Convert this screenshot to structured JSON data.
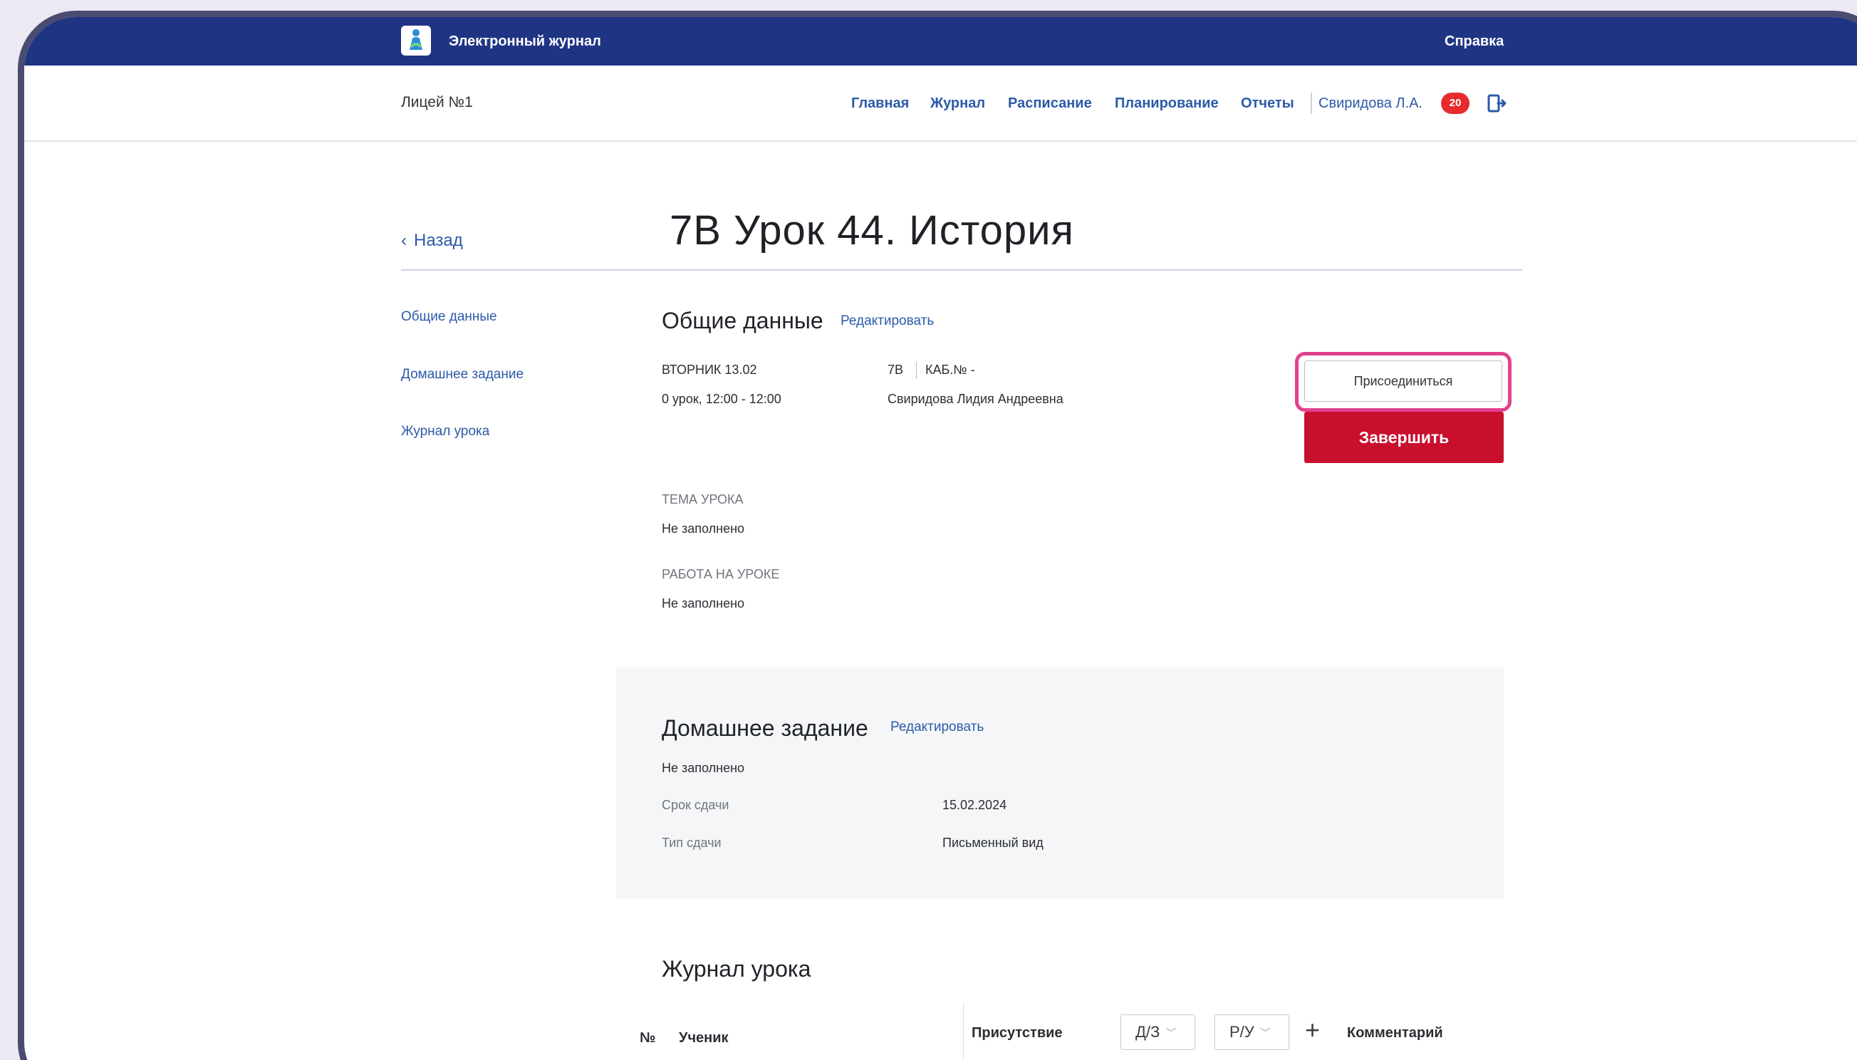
{
  "header": {
    "app_title": "Электронный журнал",
    "help": "Справка"
  },
  "nav": {
    "school": "Лицей №1",
    "items": [
      "Главная",
      "Журнал",
      "Расписание",
      "Планирование",
      "Отчеты"
    ],
    "user": "Свиридова Л.А.",
    "notifications": "20"
  },
  "page": {
    "back": "Назад",
    "title": "7В Урок 44. История"
  },
  "sidebar": {
    "items": [
      "Общие данные",
      "Домашнее задание",
      "Журнал урока"
    ]
  },
  "general": {
    "heading": "Общие данные",
    "edit": "Редактировать",
    "day": "ВТОРНИК 13.02",
    "lesson_time": "0 урок, 12:00 - 12:00",
    "class": "7В",
    "room": "КАБ.№ -",
    "teacher": "Свиридова Лидия Андреевна",
    "join": "Присоединиться",
    "finish": "Завершить",
    "topic_label": "ТЕМА УРОКА",
    "topic_value": "Не заполнено",
    "work_label": "РАБОТА НА УРОКЕ",
    "work_value": "Не заполнено"
  },
  "homework": {
    "heading": "Домашнее задание",
    "edit": "Редактировать",
    "value": "Не заполнено",
    "due_label": "Срок сдачи",
    "due_value": "15.02.2024",
    "type_label": "Тип сдачи",
    "type_value": "Письменный вид"
  },
  "journal": {
    "heading": "Журнал урока",
    "col_number": "№",
    "col_student": "Ученик",
    "col_attendance": "Присутствие",
    "select_hw": "Д/З",
    "select_class": "Р/У",
    "col_comment": "Комментарий"
  },
  "colors": {
    "header_bg": "#1f3584",
    "link": "#2c5aa8",
    "finish_bg": "#c8102e",
    "highlight": "#e2418f",
    "badge_bg": "#e52b2b"
  }
}
